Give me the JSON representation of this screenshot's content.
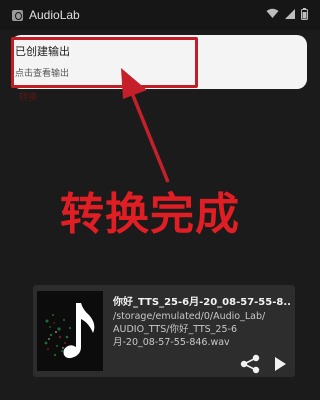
{
  "status_bar": {
    "app_name": "AudioLab",
    "icons": [
      "app-icon",
      "wifi-icon",
      "signal-icon",
      "battery-icon"
    ]
  },
  "notification": {
    "title": "已创建输出",
    "subtitle": "点击查看输出"
  },
  "ghost_label": "转换",
  "annotation": {
    "caption": "转换完成",
    "color": "#e21e25"
  },
  "media": {
    "file_name": "你好_TTS_25-6月-20_08-57-55-8...",
    "path_lines": [
      "/storage/emulated/0/Audio_Lab/",
      "AUDIO_TTS/你好_TTS_25-6",
      "月-20_08-57-55-846.wav"
    ],
    "icons": [
      "music-note-icon",
      "share-icon",
      "play-icon"
    ]
  }
}
